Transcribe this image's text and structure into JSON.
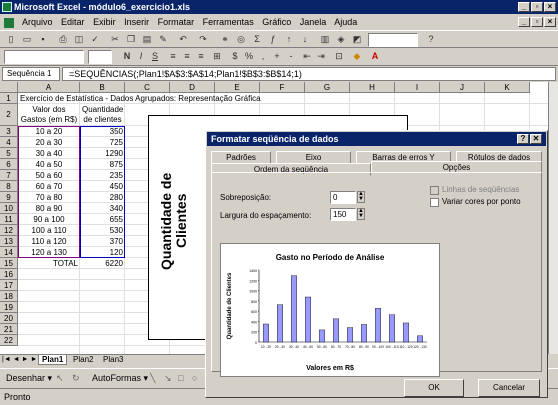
{
  "window": {
    "title": "Microsoft Excel - módulo6_exercicio1.xls"
  },
  "menu": [
    "Arquivo",
    "Editar",
    "Exibir",
    "Inserir",
    "Formatar",
    "Ferramentas",
    "Gráfico",
    "Janela",
    "Ajuda"
  ],
  "formula": {
    "namebox": "Sequência 1",
    "eq": "=",
    "content": "=SEQUÊNCIAS(;Plan1!$A$3:$A$14;Plan1!$B$3:$B$14;1)"
  },
  "columns": [
    "A",
    "B",
    "C",
    "D",
    "E",
    "F",
    "G",
    "H",
    "I",
    "J",
    "K"
  ],
  "rows": [
    "1",
    "2",
    "3",
    "4",
    "5",
    "6",
    "7",
    "8",
    "9",
    "10",
    "11",
    "12",
    "13",
    "14",
    "15",
    "16",
    "17",
    "18",
    "19",
    "20",
    "21",
    "22"
  ],
  "sheet": {
    "title": "Exercício de Estatística - Dados Agrupados: Representação Gráfica",
    "header_a1": "Valor dos",
    "header_a2": "Gastos (em R$)",
    "header_b1": "Quantidade",
    "header_b2": "de clientes",
    "data": [
      [
        "10 a 20",
        "350"
      ],
      [
        "20 a 30",
        "725"
      ],
      [
        "30 a 40",
        "1290"
      ],
      [
        "40 a 50",
        "875"
      ],
      [
        "50 a 60",
        "235"
      ],
      [
        "60 a 70",
        "450"
      ],
      [
        "70 a 80",
        "280"
      ],
      [
        "80 a 90",
        "340"
      ],
      [
        "90 a 100",
        "655"
      ],
      [
        "100 a 110",
        "530"
      ],
      [
        "110 a 120",
        "370"
      ],
      [
        "120 a 130",
        "120"
      ]
    ],
    "total_label": "TOTAL",
    "total_value": "6220"
  },
  "chart_bg": {
    "ylabel": "Quantidade de Clientes"
  },
  "sheettabs": [
    "Plan1",
    "Plan2",
    "Plan3"
  ],
  "drawbar": {
    "draw": "Desenhar ▾",
    "autoformas": "AutoFormas ▾"
  },
  "status": "Pronto",
  "dialog": {
    "title": "Formatar seqüência de dados",
    "tabs_row1": [
      "Padrões",
      "Eixo",
      "Barras de erros Y",
      "Rótulos de dados"
    ],
    "tabs_row2": [
      "Ordem da seqüência",
      "Opções"
    ],
    "overlap_label": "Sobreposição:",
    "overlap_value": "0",
    "gap_label": "Largura do espaçamento:",
    "gap_value": "150",
    "chk_lines": "Linhas de seqüências",
    "chk_vary": "Variar cores por ponto",
    "ok": "OK",
    "cancel": "Cancelar",
    "close": "✕",
    "help": "?"
  },
  "chart_data": {
    "type": "bar",
    "title": "Gasto no Período de Análise",
    "xlabel": "Valores em R$",
    "ylabel": "Quantidade de Clientes",
    "categories": [
      "10 - 20",
      "20 - 30",
      "30 - 40",
      "40 - 50",
      "50 - 60",
      "60 - 70",
      "70 - 80",
      "80 - 90",
      "90 - 100",
      "100 - 110",
      "110 - 120",
      "120 - 130"
    ],
    "values": [
      350,
      725,
      1290,
      875,
      235,
      450,
      280,
      340,
      655,
      530,
      370,
      120
    ],
    "ylim": [
      0,
      1400
    ],
    "yticks": [
      "0",
      "200",
      "400",
      "600",
      "800",
      "1000",
      "1200",
      "1400"
    ],
    "bar_color": "#9999ff"
  },
  "colors": {
    "titlebar": "#0a246a",
    "face": "#d4d0c8"
  }
}
